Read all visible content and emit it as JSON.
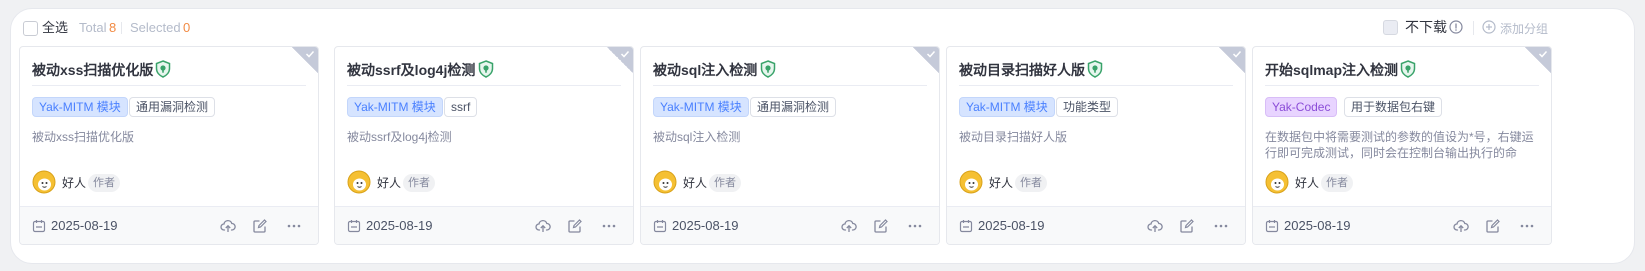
{
  "header": {
    "select_all": "全选",
    "total_label": "Total",
    "total_count": "8",
    "selected_label": "Selected",
    "selected_count": "0",
    "no_download_label": "不下载",
    "add_group_label": "添加分组"
  },
  "colors": {
    "accent_orange": "#f28b44",
    "tag_blue": "#4a80ff",
    "tag_purple": "#8b4dd8",
    "shield_green": "#39a36a"
  },
  "cards": [
    {
      "title": "被动xss扫描优化版",
      "tags": [
        "Yak-MITM 模块",
        "通用漏洞检测"
      ],
      "description": "被动xss扫描优化版",
      "author": "好人",
      "role": "作者",
      "date": "2025-08-19"
    },
    {
      "title": "被动ssrf及log4j检测",
      "tags": [
        "Yak-MITM 模块",
        "ssrf"
      ],
      "description": "被动ssrf及log4j检测",
      "author": "好人",
      "role": "作者",
      "date": "2025-08-19"
    },
    {
      "title": "被动sql注入检测",
      "tags": [
        "Yak-MITM 模块",
        "通用漏洞检测"
      ],
      "description": "被动sql注入检测",
      "author": "好人",
      "role": "作者",
      "date": "2025-08-19"
    },
    {
      "title": "被动目录扫描好人版",
      "tags": [
        "Yak-MITM 模块",
        "功能类型"
      ],
      "description": "被动目录扫描好人版",
      "author": "好人",
      "role": "作者",
      "date": "2025-08-19"
    },
    {
      "title": "开始sqlmap注入检测",
      "tags": [
        "Yak-Codec",
        "用于数据包右键"
      ],
      "description": "在数据包中将需要测试的参数的值设为*号，右键运行即可完成测试，同时会在控制台输出执行的命令。使...",
      "author": "好人",
      "role": "作者",
      "date": "2025-08-19"
    }
  ]
}
